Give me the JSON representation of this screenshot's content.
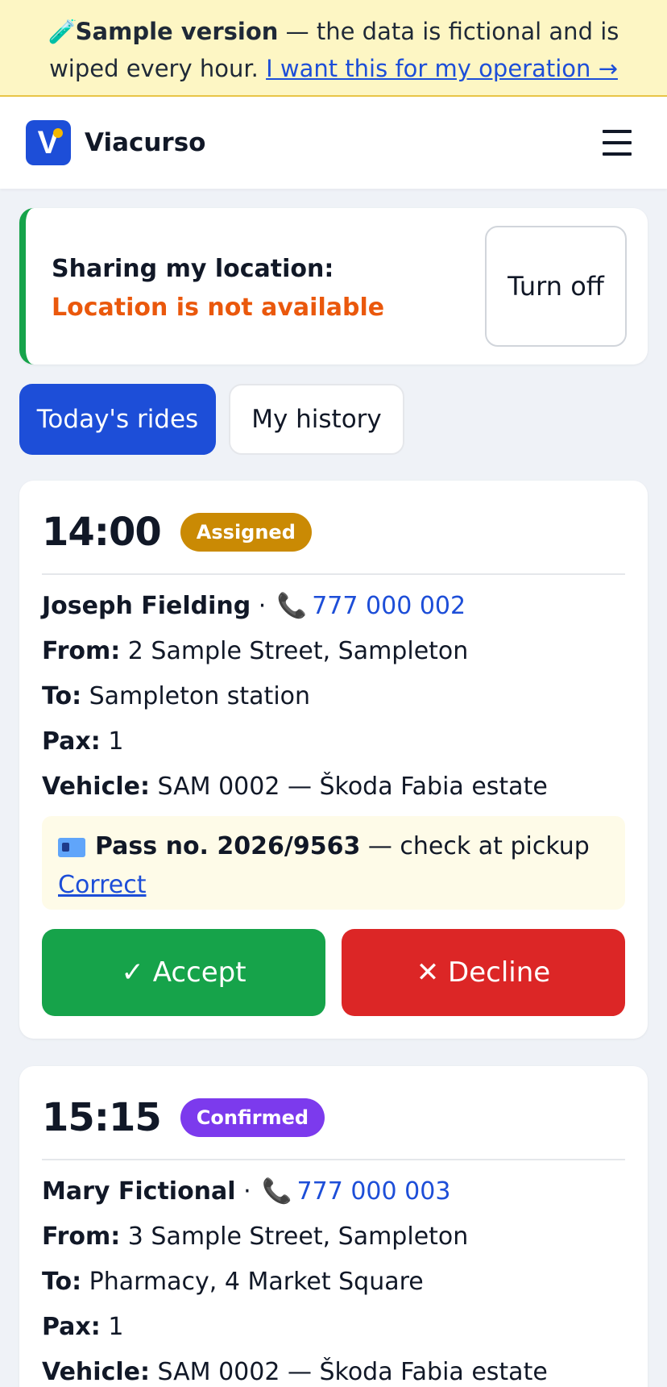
{
  "banner": {
    "icon": "test-tube-icon",
    "bold": "Sample version",
    "text": " — the data is fictional and is wiped every hour. ",
    "link": "I want this for my operation →"
  },
  "header": {
    "logo_letter": "V",
    "brand": "Viacurso",
    "menu_icon": "hamburger-menu-icon"
  },
  "location": {
    "label": "Sharing my location: ",
    "status": "Location is not available",
    "button": "Turn off"
  },
  "tabs": [
    {
      "label": "Today's rides",
      "active": true
    },
    {
      "label": "My history",
      "active": false
    }
  ],
  "rides": [
    {
      "time": "14:00",
      "badge": "Assigned",
      "badge_color": "#ca8a04",
      "name": "Joseph Fielding",
      "sep": " · ",
      "phone": "777 000 002",
      "from_label": "From:",
      "from": " 2 Sample Street, Sampleton",
      "to_label": "To:",
      "to": " Sampleton station",
      "pax_label": "Pax:",
      "pax": " 1",
      "vehicle_label": "Vehicle:",
      "vehicle": " SAM 0002 — Škoda Fabia estate",
      "pass_bold": "Pass no. 2026/9563",
      "pass_text": " — check at pickup",
      "pass_link": "Correct",
      "accept": "✓ Accept",
      "decline": "✕ Decline"
    },
    {
      "time": "15:15",
      "badge": "Confirmed",
      "badge_color": "#7c3aed",
      "name": "Mary Fictional",
      "sep": " · ",
      "phone": "777 000 003",
      "from_label": "From:",
      "from": " 3 Sample Street, Sampleton",
      "to_label": "To:",
      "to": " Pharmacy, 4 Market Square",
      "pax_label": "Pax:",
      "pax": " 1",
      "vehicle_label": "Vehicle:",
      "vehicle": " SAM 0002 — Škoda Fabia estate"
    }
  ]
}
